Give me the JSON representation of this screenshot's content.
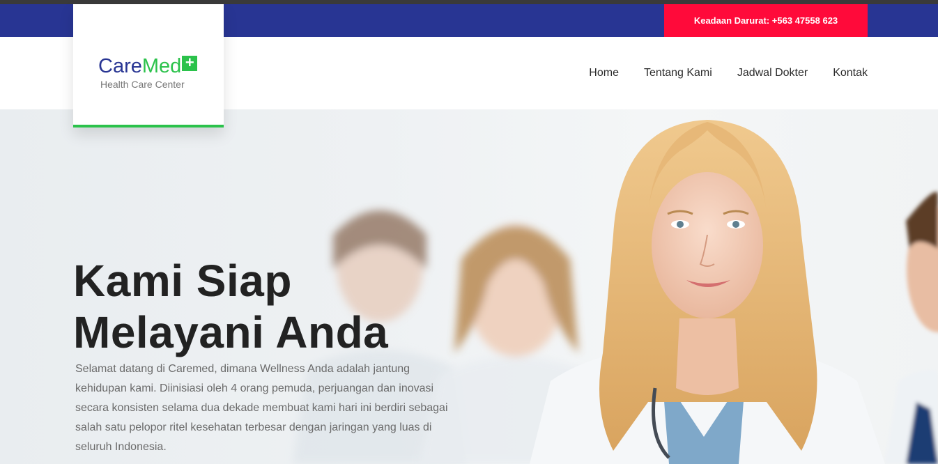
{
  "topbar": {
    "emergency_label": "Keadaan Darurat: +563 47558 623"
  },
  "logo": {
    "name_part1": "Care",
    "name_part2": "Med",
    "plus_symbol": "+",
    "tagline": "Health Care Center"
  },
  "nav": {
    "items": [
      "Home",
      "Tentang Kami",
      "Jadwal Dokter",
      "Kontak"
    ]
  },
  "hero": {
    "title_line1": "Kami Siap",
    "title_line2": "Melayani Anda",
    "description": "Selamat datang di Caremed, dimana Wellness Anda adalah jantung kehidupan kami. Diinisiasi oleh 4 orang pemuda, perjuangan dan inovasi secara konsisten selama dua dekade membuat kami hari ini berdiri sebagai salah satu pelopor ritel kesehatan terbesar dengan jaringan yang luas di seluruh Indonesia."
  },
  "colors": {
    "primary": "#283593",
    "accent_green": "#2bc24b",
    "emergency_red": "#ff0a3a"
  }
}
